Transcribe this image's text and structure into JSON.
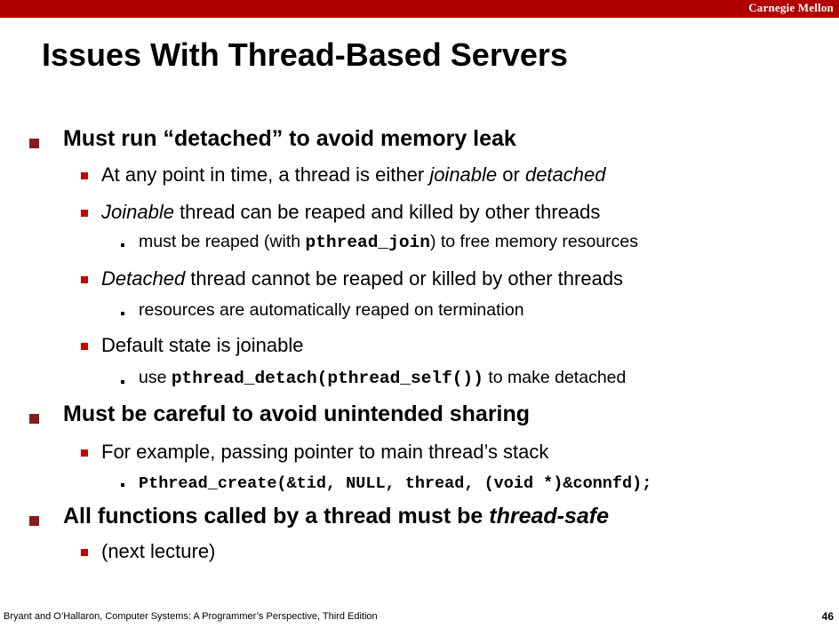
{
  "header": {
    "brand": "Carnegie Mellon"
  },
  "slide": {
    "title": "Issues With Thread-Based Servers",
    "b1": {
      "text": "Must run “detached” to avoid memory leak",
      "s1": {
        "pre": "At any point in time, a thread is either ",
        "em1": "joinable",
        "mid": " or ",
        "em2": "detached"
      },
      "s2": {
        "em": "Joinable",
        "rest": " thread can be reaped and killed by other threads",
        "sub": {
          "pre": "must be reaped (with ",
          "code": "pthread_join",
          "post": ") to free memory resources"
        }
      },
      "s3": {
        "em": "Detached",
        "rest": " thread cannot be reaped or killed by other threads",
        "sub": {
          "text": "resources are automatically reaped on termination"
        }
      },
      "s4": {
        "text": "Default state is joinable",
        "sub": {
          "pre": "use ",
          "code": "pthread_detach(pthread_self())",
          "post": " to make detached"
        }
      }
    },
    "b2": {
      "text": "Must be careful to avoid unintended sharing",
      "s1": {
        "text": "For example, passing pointer to main thread’s stack",
        "sub": {
          "code": "Pthread_create(&tid, NULL, thread, (void *)&connfd);"
        }
      }
    },
    "b3": {
      "pre": "All functions called by a thread must be ",
      "em": "thread-safe",
      "s1": {
        "text": "(next lecture)"
      }
    }
  },
  "footer": {
    "credit": "Bryant and O’Hallaron, Computer Systems: A Programmer’s Perspective, Third Edition",
    "page": "46"
  }
}
